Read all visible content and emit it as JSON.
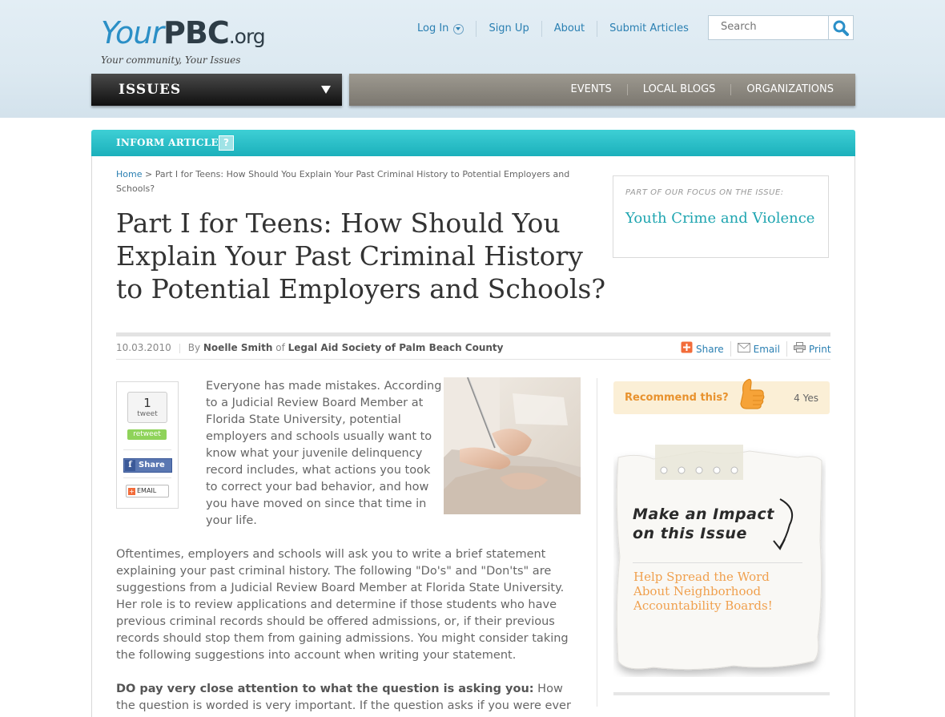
{
  "logo": {
    "your": "Your",
    "pbc": "PBC",
    "org": ".org",
    "tagline": "Your community, Your Issues"
  },
  "topnav": {
    "login": "Log In",
    "signup": "Sign Up",
    "about": "About",
    "submit": "Submit Articles"
  },
  "search": {
    "placeholder": "Search"
  },
  "issues_menu": {
    "label": "ISSUES"
  },
  "secondary_nav": {
    "events": "EVENTS",
    "local_blogs": "LOCAL BLOGS",
    "organizations": "ORGANIZATIONS"
  },
  "section": {
    "label": "INFORM ARTICLE",
    "help": "?"
  },
  "breadcrumb": {
    "home": "Home",
    "separator": ">",
    "current": "Part I for Teens: How Should You Explain Your Past Criminal History to Potential Employers and Schools?"
  },
  "article": {
    "title": "Part I for Teens: How Should You Explain Your Past Criminal History to Potential Employers and Schools?",
    "date": "10.03.2010",
    "by": "By",
    "author": "Noelle Smith",
    "of": "of",
    "organization": "Legal Aid Society of Palm Beach County",
    "para1": "Everyone has made mistakes. According to a Judicial Review Board Member at Florida State University, potential employers and schools usually want to know what your juvenile delinquency record includes, what actions you took to correct your bad behavior, and how you have moved on since that time in your life.",
    "para2": "Oftentimes, employers and schools will ask you to write a brief statement explaining your past criminal history. The following \"Do's\" and \"Don'ts\" are suggestions from a Judicial Review Board Member at Florida State University. Her role is to review applications and determine if those students who have previous criminal records should be offered admissions, or, if their previous records should stop them from gaining admissions. You might consider taking the following suggestions into account when writing your statement.",
    "para3_bold": "DO pay very close attention to what the question is asking you:",
    "para3_rest": " How the question is worded is very important. If the question asks if you were ever"
  },
  "tools": {
    "share": "Share",
    "email": "Email",
    "print": "Print"
  },
  "social": {
    "tweet_count": "1",
    "tweet_label": "tweet",
    "retweet": "retweet",
    "fb_share": "Share",
    "email": "EMAIL"
  },
  "focus": {
    "label": "PART OF OUR FOCUS ON THE ISSUE:",
    "issue": "Youth Crime and Violence"
  },
  "recommend": {
    "label": "Recommend this?",
    "count": "4 Yes"
  },
  "impact": {
    "title_line1": "Make an Impact",
    "title_line2": "on this Issue",
    "link": "Help Spread the Word About Neighborhood Accountability Boards!"
  },
  "colors": {
    "link_blue": "#2a7fb2",
    "teal": "#1fb0bb",
    "orange": "#f0a04e",
    "dark_bar": "#1a1a1a",
    "gray_bar": "#8c887f"
  }
}
